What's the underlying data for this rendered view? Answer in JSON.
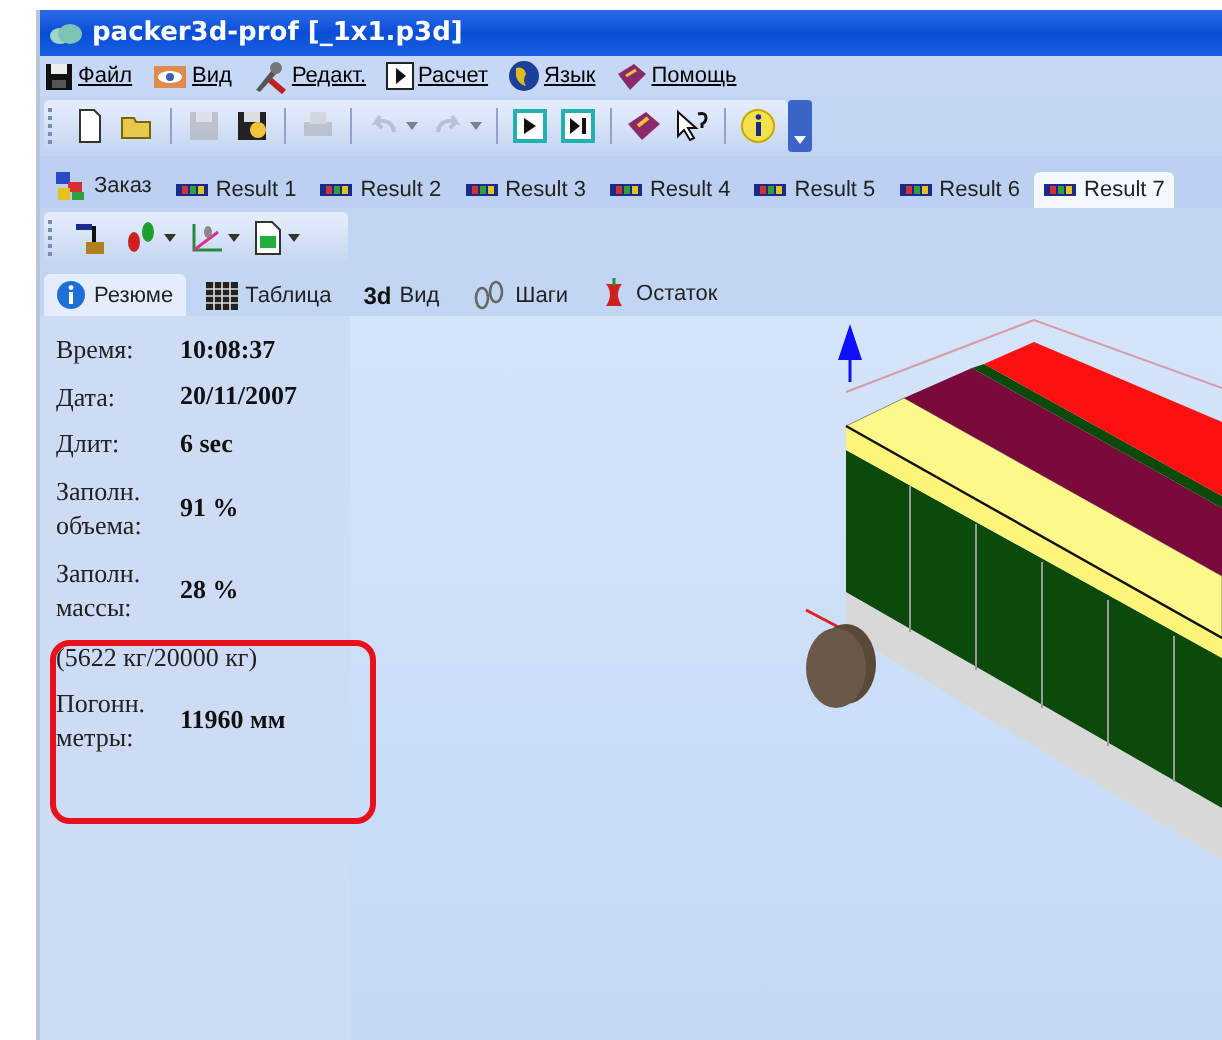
{
  "window": {
    "title": "packer3d-prof [_1x1.p3d]"
  },
  "menu": [
    {
      "label": "Файл",
      "kind": "file"
    },
    {
      "label": "Вид",
      "kind": "view"
    },
    {
      "label": "Редакт.",
      "kind": "edit"
    },
    {
      "label": "Расчет",
      "kind": "calc"
    },
    {
      "label": "Язык",
      "kind": "language"
    },
    {
      "label": "Помощь",
      "kind": "help"
    }
  ],
  "toolbar": [
    {
      "kind": "new",
      "disabled": false
    },
    {
      "kind": "open",
      "disabled": false
    },
    {
      "kind": "separator"
    },
    {
      "kind": "save",
      "disabled": true
    },
    {
      "kind": "save-as",
      "disabled": false
    },
    {
      "kind": "separator"
    },
    {
      "kind": "print",
      "disabled": true
    },
    {
      "kind": "separator"
    },
    {
      "kind": "undo",
      "disabled": true
    },
    {
      "kind": "redo",
      "disabled": true
    },
    {
      "kind": "separator"
    },
    {
      "kind": "run",
      "disabled": false
    },
    {
      "kind": "step",
      "disabled": false
    },
    {
      "kind": "separator"
    },
    {
      "kind": "book",
      "disabled": false
    },
    {
      "kind": "help",
      "disabled": false
    },
    {
      "kind": "separator"
    },
    {
      "kind": "info",
      "disabled": false
    }
  ],
  "result_tabs": [
    {
      "label": "Заказ",
      "kind": "order",
      "selected": false
    },
    {
      "label": "Result 1",
      "kind": "result",
      "selected": false
    },
    {
      "label": "Result 2",
      "kind": "result",
      "selected": false
    },
    {
      "label": "Result 3",
      "kind": "result",
      "selected": false
    },
    {
      "label": "Result 4",
      "kind": "result",
      "selected": false
    },
    {
      "label": "Result 5",
      "kind": "result",
      "selected": false
    },
    {
      "label": "Result 6",
      "kind": "result",
      "selected": false
    },
    {
      "label": "Result 7",
      "kind": "result",
      "selected": true
    }
  ],
  "view_tabs": [
    {
      "label": "Резюме",
      "kind": "info",
      "selected": true
    },
    {
      "label": "Таблица",
      "kind": "grid",
      "selected": false
    },
    {
      "label": "Вид",
      "kind": "model",
      "selected": false
    },
    {
      "label": "Шаги",
      "kind": "steps",
      "selected": false
    },
    {
      "label": "Остаток",
      "kind": "rest",
      "selected": false
    }
  ],
  "view_tab_3d_mark": "3d",
  "summary": [
    {
      "label": "Время:",
      "value": "10:08:37"
    },
    {
      "label": "Дата:",
      "value": "20/11/2007"
    },
    {
      "label": "Длит:",
      "value": "6 sec"
    },
    {
      "label": "Заполн. объема:",
      "value": "91 %"
    },
    {
      "label": "Заполн. массы:",
      "value": "28 %"
    }
  ],
  "mass_note": "(5622 кг/20000 кг)",
  "highlighted": {
    "label": "Погонн. метры:",
    "value": "11960 мм"
  }
}
